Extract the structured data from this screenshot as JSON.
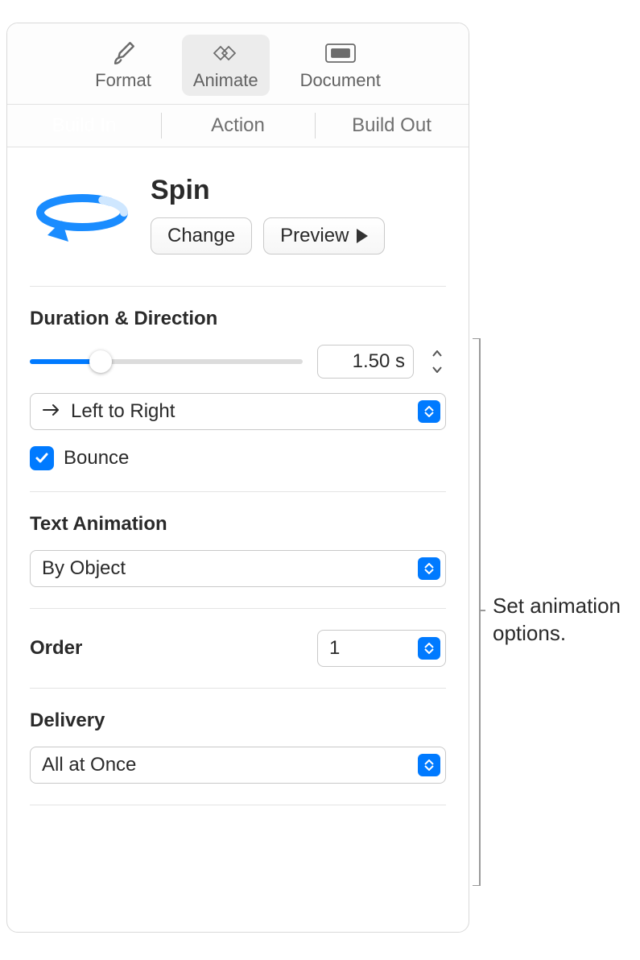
{
  "toolbar": {
    "format": "Format",
    "animate": "Animate",
    "document": "Document"
  },
  "tabs": {
    "buildIn": "Build In",
    "action": "Action",
    "buildOut": "Build Out"
  },
  "effect": {
    "name": "Spin",
    "changeLabel": "Change",
    "previewLabel": "Preview"
  },
  "duration": {
    "title": "Duration & Direction",
    "value": "1.50 s",
    "direction": "Left to Right",
    "bounceLabel": "Bounce",
    "bounceChecked": true
  },
  "textAnimation": {
    "title": "Text Animation",
    "value": "By Object"
  },
  "order": {
    "title": "Order",
    "value": "1"
  },
  "delivery": {
    "title": "Delivery",
    "value": "All at Once"
  },
  "callout": "Set animation options."
}
